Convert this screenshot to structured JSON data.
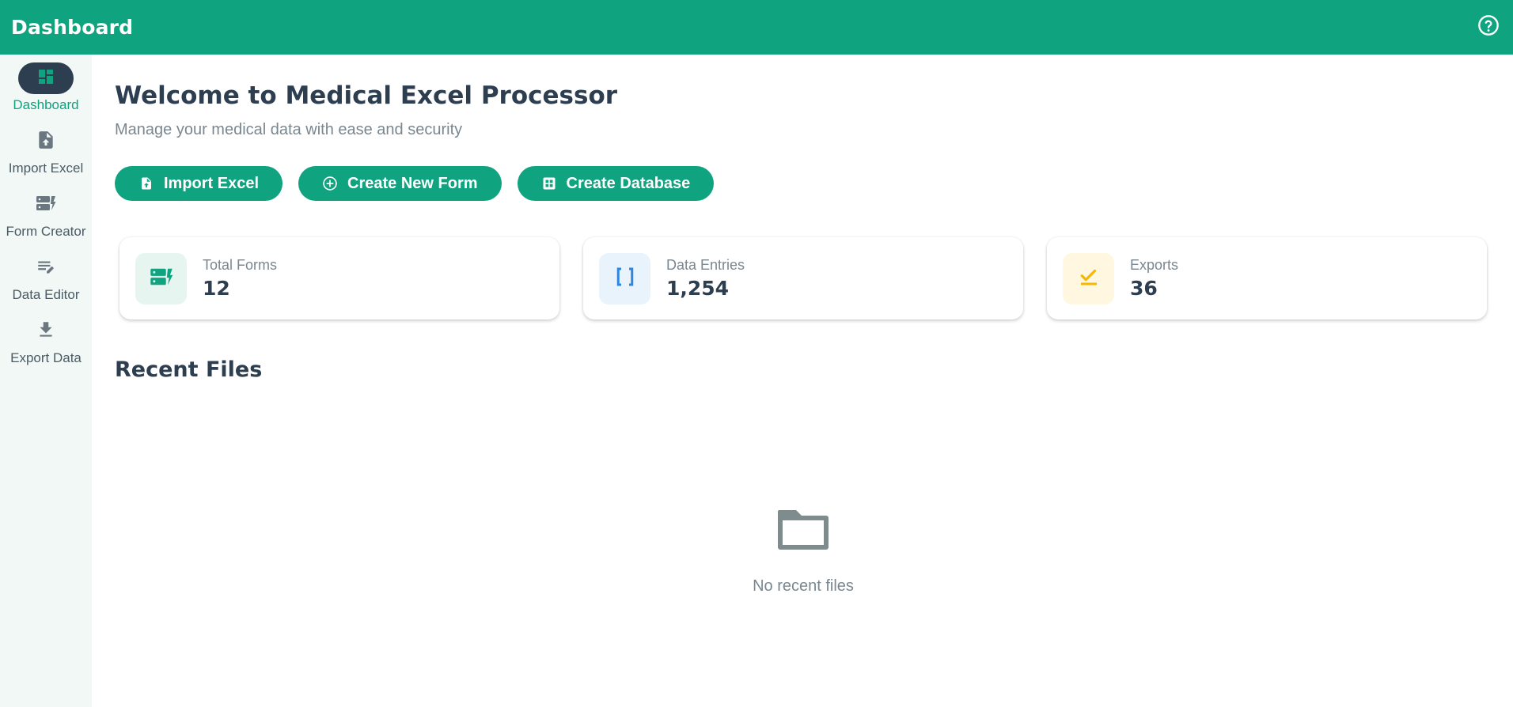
{
  "header": {
    "title": "Dashboard",
    "help_icon": "help-circle-icon"
  },
  "sidebar": {
    "items": [
      {
        "label": "Dashboard",
        "icon": "dashboard-icon",
        "active": true
      },
      {
        "label": "Import Excel",
        "icon": "file-upload-icon",
        "active": false
      },
      {
        "label": "Form Creator",
        "icon": "form-icon",
        "active": false
      },
      {
        "label": "Data Editor",
        "icon": "edit-list-icon",
        "active": false
      },
      {
        "label": "Export Data",
        "icon": "download-icon",
        "active": false
      }
    ]
  },
  "main": {
    "title": "Welcome to Medical Excel Processor",
    "subtitle": "Manage your medical data with ease and security",
    "actions": [
      {
        "label": "Import Excel",
        "icon": "file-upload-icon"
      },
      {
        "label": "Create New Form",
        "icon": "plus-circle-icon"
      },
      {
        "label": "Create Database",
        "icon": "grid-icon"
      }
    ],
    "stats": [
      {
        "label": "Total Forms",
        "value": "12",
        "icon": "form-icon",
        "color": "#10a37f",
        "bg": "#e6f5f0"
      },
      {
        "label": "Data Entries",
        "value": "1,254",
        "icon": "brackets-icon",
        "color": "#2e86de",
        "bg": "#e8f3fc"
      },
      {
        "label": "Exports",
        "value": "36",
        "icon": "check-underline-icon",
        "color": "#f6b800",
        "bg": "#fff7e0"
      }
    ],
    "recent": {
      "title": "Recent Files",
      "empty_label": "No recent files",
      "empty_icon": "folder-icon"
    }
  },
  "colors": {
    "accent": "#10a37f",
    "dark": "#2c3e50",
    "muted": "#7a8790",
    "sidebar_bg": "#f1f8f5"
  }
}
